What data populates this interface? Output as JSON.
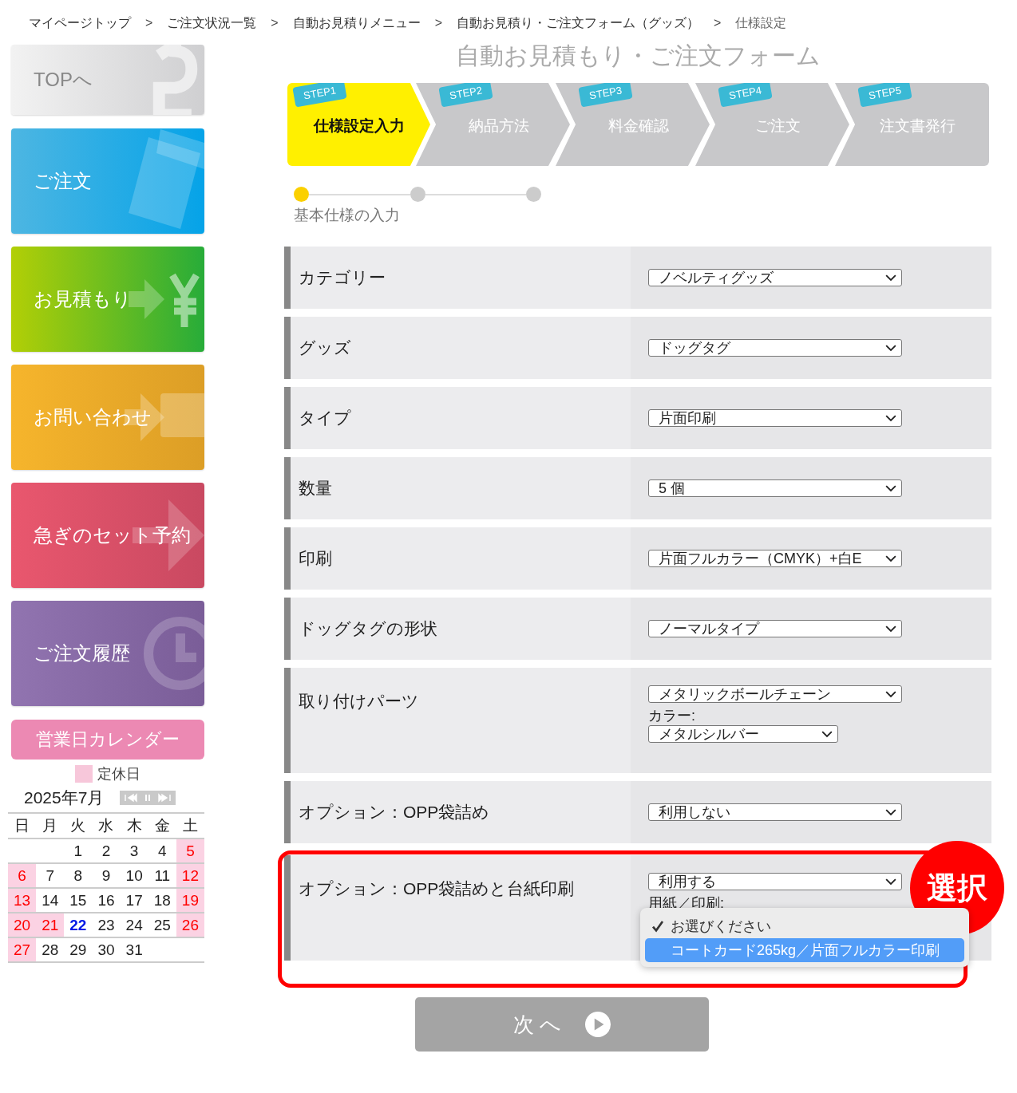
{
  "breadcrumb": {
    "separator": ">",
    "items": [
      {
        "label": "マイページトップ",
        "link": true
      },
      {
        "label": "ご注文状況一覧",
        "link": true
      },
      {
        "label": "自動お見積りメニュー",
        "link": true
      },
      {
        "label": "自動お見積り・ご注文フォーム（グッズ）",
        "link": true
      },
      {
        "label": "仕様設定",
        "link": false
      }
    ]
  },
  "sidebar": {
    "items": [
      {
        "label": "TOPへ",
        "kind": "top"
      },
      {
        "label": "ご注文",
        "kind": "order"
      },
      {
        "label": "お見積もり",
        "kind": "estimate"
      },
      {
        "label": "お問い合わせ",
        "kind": "contact"
      },
      {
        "label": "急ぎのセット予約",
        "kind": "rush"
      },
      {
        "label": "ご注文履歴",
        "kind": "history"
      }
    ]
  },
  "calendar": {
    "title": "営業日カレンダー",
    "legend": "定休日",
    "month": "2025年7月",
    "weekdays": [
      "日",
      "月",
      "火",
      "水",
      "木",
      "金",
      "土"
    ],
    "weeks": [
      [
        {
          "kind": "blank"
        },
        {
          "kind": "blank"
        },
        {
          "kind": "day",
          "day": "1",
          "holiday": false,
          "today": false
        },
        {
          "kind": "day",
          "day": "2",
          "holiday": false,
          "today": false
        },
        {
          "kind": "day",
          "day": "3",
          "holiday": false,
          "today": false
        },
        {
          "kind": "day",
          "day": "4",
          "holiday": false,
          "today": false
        },
        {
          "kind": "day",
          "day": "5",
          "holiday": true,
          "today": false
        }
      ],
      [
        {
          "kind": "day",
          "day": "6",
          "holiday": true,
          "today": false
        },
        {
          "kind": "day",
          "day": "7",
          "holiday": false,
          "today": false
        },
        {
          "kind": "day",
          "day": "8",
          "holiday": false,
          "today": false
        },
        {
          "kind": "day",
          "day": "9",
          "holiday": false,
          "today": false
        },
        {
          "kind": "day",
          "day": "10",
          "holiday": false,
          "today": false
        },
        {
          "kind": "day",
          "day": "11",
          "holiday": false,
          "today": false
        },
        {
          "kind": "day",
          "day": "12",
          "holiday": true,
          "today": false
        }
      ],
      [
        {
          "kind": "day",
          "day": "13",
          "holiday": true,
          "today": false
        },
        {
          "kind": "day",
          "day": "14",
          "holiday": false,
          "today": false
        },
        {
          "kind": "day",
          "day": "15",
          "holiday": false,
          "today": false
        },
        {
          "kind": "day",
          "day": "16",
          "holiday": false,
          "today": false
        },
        {
          "kind": "day",
          "day": "17",
          "holiday": false,
          "today": false
        },
        {
          "kind": "day",
          "day": "18",
          "holiday": false,
          "today": false
        },
        {
          "kind": "day",
          "day": "19",
          "holiday": true,
          "today": false
        }
      ],
      [
        {
          "kind": "day",
          "day": "20",
          "holiday": true,
          "today": false
        },
        {
          "kind": "day",
          "day": "21",
          "holiday": true,
          "today": false
        },
        {
          "kind": "day",
          "day": "22",
          "holiday": false,
          "today": true
        },
        {
          "kind": "day",
          "day": "23",
          "holiday": false,
          "today": false
        },
        {
          "kind": "day",
          "day": "24",
          "holiday": false,
          "today": false
        },
        {
          "kind": "day",
          "day": "25",
          "holiday": false,
          "today": false
        },
        {
          "kind": "day",
          "day": "26",
          "holiday": true,
          "today": false
        }
      ],
      [
        {
          "kind": "day",
          "day": "27",
          "holiday": true,
          "today": false
        },
        {
          "kind": "day",
          "day": "28",
          "holiday": false,
          "today": false
        },
        {
          "kind": "day",
          "day": "29",
          "holiday": false,
          "today": false
        },
        {
          "kind": "day",
          "day": "30",
          "holiday": false,
          "today": false
        },
        {
          "kind": "day",
          "day": "31",
          "holiday": false,
          "today": false
        },
        {
          "kind": "blank"
        },
        {
          "kind": "blank"
        }
      ]
    ]
  },
  "heading": "自動お見積もり・ご注文フォーム",
  "steps": [
    {
      "badge": "STEP1",
      "label": "仕様設定入力",
      "selected": true
    },
    {
      "badge": "STEP2",
      "label": "納品方法",
      "selected": false
    },
    {
      "badge": "STEP3",
      "label": "料金確認",
      "selected": false
    },
    {
      "badge": "STEP4",
      "label": "ご注文",
      "selected": false
    },
    {
      "badge": "STEP5",
      "label": "注文書発行",
      "selected": false
    }
  ],
  "progress": {
    "label": "基本仕様の入力",
    "dots": [
      {
        "selected": true
      },
      {
        "selected": false
      },
      {
        "selected": false
      }
    ]
  },
  "form": {
    "rows": [
      {
        "label": "カテゴリー",
        "fields": [
          {
            "kind": "select",
            "value": "ノベルティグッズ"
          }
        ]
      },
      {
        "label": "グッズ",
        "fields": [
          {
            "kind": "select",
            "value": "ドッグタグ"
          }
        ]
      },
      {
        "label": "タイプ",
        "fields": [
          {
            "kind": "select",
            "value": "片面印刷"
          }
        ]
      },
      {
        "label": "数量",
        "fields": [
          {
            "kind": "select",
            "value": "5 個"
          }
        ]
      },
      {
        "label": "印刷",
        "fields": [
          {
            "kind": "select",
            "value": "片面フルカラー（CMYK）+白E"
          }
        ]
      },
      {
        "label": "ドッグタグの形状",
        "fields": [
          {
            "kind": "select",
            "value": "ノーマルタイプ"
          }
        ]
      },
      {
        "label": "取り付けパーツ",
        "fields": [
          {
            "kind": "select",
            "value": "メタリックボールチェーン"
          },
          {
            "kind": "label",
            "text": "カラー:"
          },
          {
            "kind": "select",
            "value": "メタルシルバー",
            "short": true
          }
        ]
      },
      {
        "label": "オプション：OPP袋詰め",
        "fields": [
          {
            "kind": "select",
            "value": "利用しない"
          }
        ]
      },
      {
        "label": "オプション：OPP袋詰めと台紙印刷",
        "highlighted": true,
        "fields": [
          {
            "kind": "select",
            "value": "利用する"
          },
          {
            "kind": "label",
            "text": "用紙／印刷:"
          }
        ],
        "popup": [
          {
            "label": "お選びください",
            "checked": true,
            "selected": false
          },
          {
            "label": "コートカード265kg／片面フルカラー印刷",
            "checked": false,
            "selected": true
          }
        ]
      }
    ]
  },
  "callout": "選択",
  "next_button": "次 へ"
}
